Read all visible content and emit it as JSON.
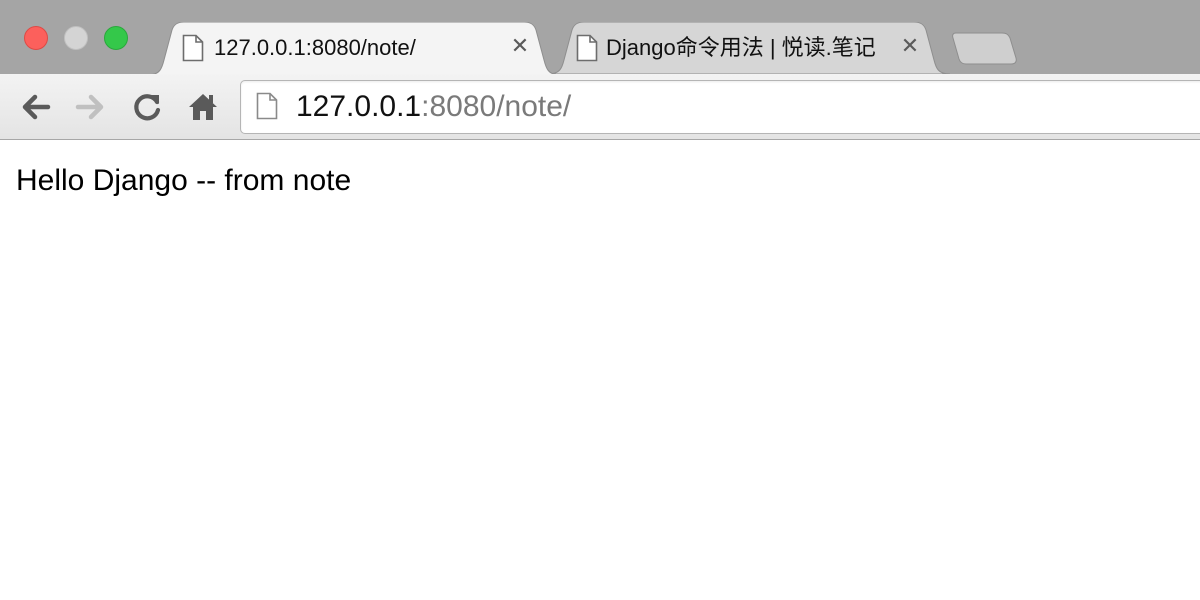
{
  "window": {
    "controls": [
      "close",
      "minimize",
      "zoom"
    ]
  },
  "tabs": [
    {
      "title": "127.0.0.1:8080/note/",
      "icon": "page-icon",
      "active": true,
      "close_symbol": "✕"
    },
    {
      "title": "Django命令用法 | 悦读.笔记",
      "icon": "page-icon",
      "active": false,
      "close_symbol": "✕"
    }
  ],
  "toolbar": {
    "back_icon": "back-arrow-icon",
    "forward_icon": "forward-arrow-icon",
    "reload_icon": "reload-icon",
    "home_icon": "home-icon"
  },
  "omnibox": {
    "url_host": "127.0.0.1",
    "url_rest": ":8080/note/"
  },
  "page": {
    "text": "Hello Django -- from note"
  },
  "colors": {
    "tabstrip": "#a5a5a5",
    "toolbar": "#ececec",
    "close_light": "#fc605c",
    "minimize_light": "#d4d4d4",
    "zoom_light": "#34c84a"
  }
}
